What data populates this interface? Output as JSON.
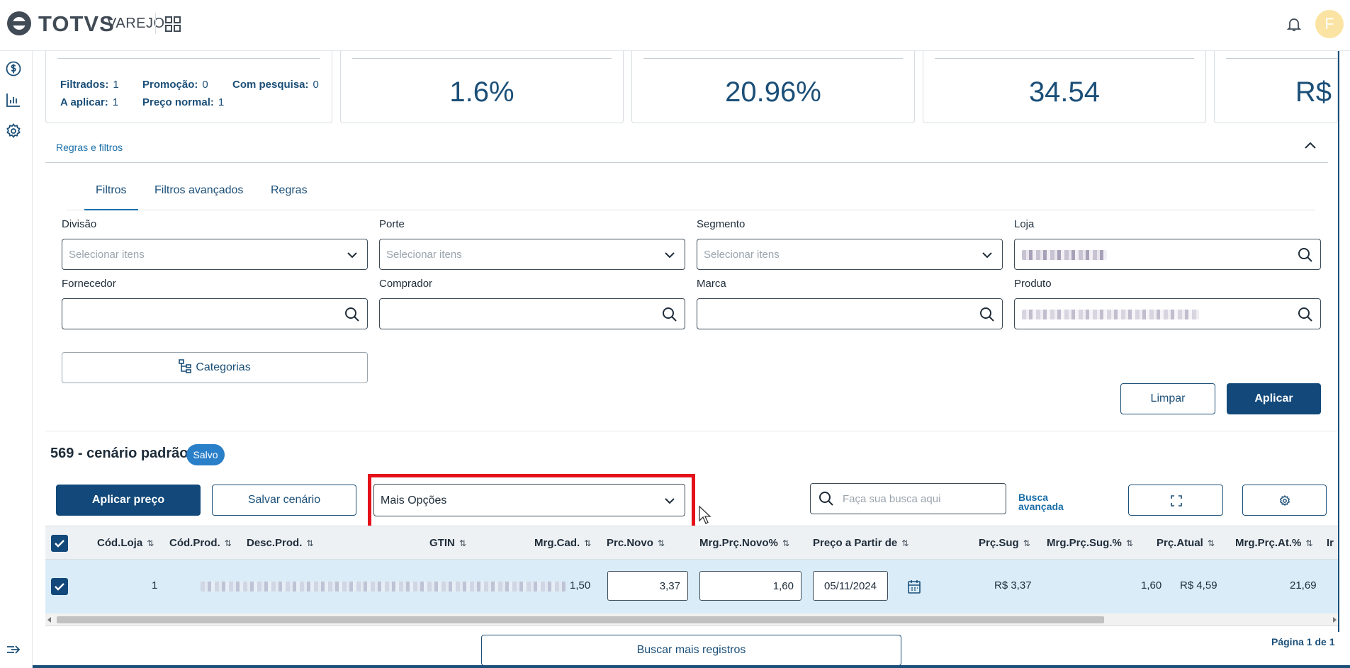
{
  "brand": {
    "name": "TOTVS",
    "product": "VAREJO"
  },
  "user": {
    "initial": "F"
  },
  "stats": {
    "filtrados_label": "Filtrados:",
    "filtrados_value": "1",
    "promocao_label": "Promoção:",
    "promocao_value": "0",
    "com_pesquisa_label": "Com pesquisa:",
    "com_pesquisa_value": "0",
    "a_aplicar_label": "A aplicar:",
    "a_aplicar_value": "1",
    "preco_normal_label": "Preço normal:",
    "preco_normal_value": "1",
    "cards": [
      "1.6%",
      "20.96%",
      "34.54",
      "R$"
    ]
  },
  "rules": {
    "title": "Regras e filtros",
    "tabs": [
      "Filtros",
      "Filtros avançados",
      "Regras"
    ],
    "fields": {
      "divisao": {
        "label": "Divisão",
        "placeholder": "Selecionar itens"
      },
      "porte": {
        "label": "Porte",
        "placeholder": "Selecionar itens"
      },
      "segmento": {
        "label": "Segmento",
        "placeholder": "Selecionar itens"
      },
      "loja": {
        "label": "Loja"
      },
      "fornecedor": {
        "label": "Fornecedor"
      },
      "comprador": {
        "label": "Comprador"
      },
      "marca": {
        "label": "Marca"
      },
      "produto": {
        "label": "Produto"
      }
    },
    "categorias": "Categorias",
    "limpar": "Limpar",
    "aplicar": "Aplicar"
  },
  "scenario": {
    "title": "569 - cenário padrão",
    "status": "Salvo"
  },
  "toolbar": {
    "aplicar_preco": "Aplicar preço",
    "salvar_cenario": "Salvar cenário",
    "mais_opcoes": "Mais Opções",
    "search_placeholder": "Faça sua busca aqui",
    "busca_avancada": "Busca avançada"
  },
  "table": {
    "columns": [
      "Cód.Loja",
      "Cód.Prod.",
      "Desc.Prod.",
      "GTIN",
      "Mrg.Cad.",
      "Prc.Novo",
      "Mrg.Prç.Novo%",
      "Preço a Partir de",
      "Prç.Sug",
      "Mrg.Prç.Sug.%",
      "Prç.Atual",
      "Mrg.Prç.At.%",
      "Ir"
    ],
    "rows": [
      {
        "cod_loja": "1",
        "mrg_cad": "1,50",
        "prc_novo": "3,37",
        "mrg_prc_novo": "1,60",
        "preco_a_partir": "05/11/2024",
        "prc_sug": "R$ 3,37",
        "mrg_prc_sug": "1,60",
        "prc_atual": "R$ 4,59",
        "mrg_prc_at": "21,69"
      }
    ]
  },
  "buscar_mais": "Buscar mais registros",
  "pagination": "Página 1 de 1",
  "colors": {
    "primary": "#12497a",
    "accent": "#1b6fa8",
    "highlight": "#e4111a",
    "row": "#d9ecf8"
  }
}
